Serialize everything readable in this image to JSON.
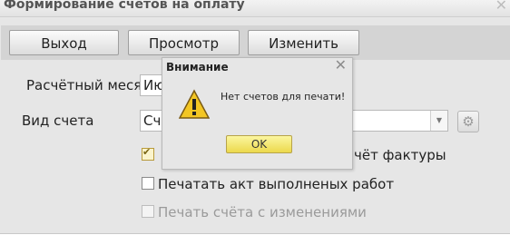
{
  "window": {
    "title": "Формирование счетов на оплату"
  },
  "toolbar": {
    "exit_label": "Выход",
    "preview_label": "Просмотр",
    "edit_label": "Изменить"
  },
  "form": {
    "month_label": "Расчётный месяц",
    "month_value": "Ию",
    "type_label": "Вид счета",
    "type_value": "Сч",
    "print_invoice_suffix": "чёт фактуры",
    "print_act_label": "Печатать акт выполненых работ",
    "print_changed_label": "Печать счёта с изменениями"
  },
  "dialog": {
    "title": "Внимание",
    "message": "Нет счетов для печати!",
    "ok_label": "OK"
  },
  "icons": {
    "window_close": "close-icon",
    "dialog_close": "close-icon",
    "warning": "warning-icon",
    "gear": "gear-icon",
    "dropdown": "chevron-down-icon"
  },
  "colors": {
    "window_bg": "#e6e6e6",
    "toolbar_bg": "#d4d4d4",
    "ok_button": "#f1e06a",
    "warning_yellow": "#f3c623"
  }
}
